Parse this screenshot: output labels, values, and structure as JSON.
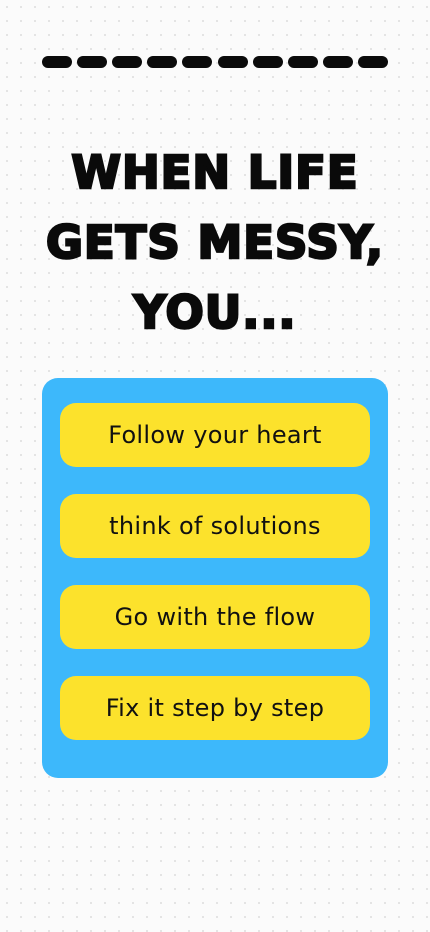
{
  "progress": {
    "total_steps": 10
  },
  "question": {
    "lines": [
      "WHEN LIFE",
      "GETS MESSY,",
      "YOU..."
    ]
  },
  "options": [
    {
      "label": "Follow your heart"
    },
    {
      "label": "think of solutions"
    },
    {
      "label": "Go with the flow"
    },
    {
      "label": "Fix it step by step"
    }
  ],
  "colors": {
    "panel": "#3db8fb",
    "option": "#fce22c",
    "text": "#0a0a0a"
  }
}
